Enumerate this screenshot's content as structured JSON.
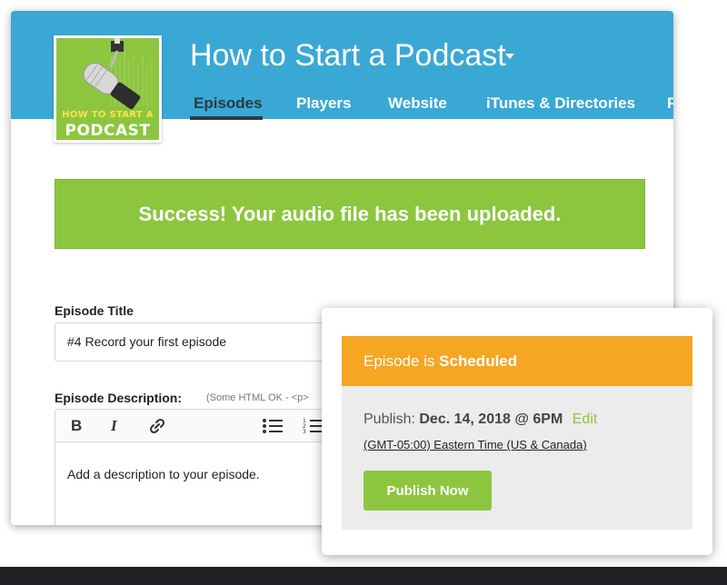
{
  "podcast": {
    "title": "How to Start a Podcast",
    "artwork": {
      "line1": "HOW TO START A",
      "line2": "PODCAST",
      "bg_color": "#8cc63f"
    }
  },
  "tabs": [
    {
      "label": "Episodes",
      "active": true
    },
    {
      "label": "Players",
      "active": false
    },
    {
      "label": "Website",
      "active": false
    },
    {
      "label": "iTunes & Directories",
      "active": false
    },
    {
      "label": "P",
      "active": false
    }
  ],
  "banner": {
    "text": "Success! Your audio file has been uploaded.",
    "color": "#8cc63f"
  },
  "form": {
    "episode_title_label": "Episode Title",
    "episode_title_value": "#4 Record your first episode",
    "description_label": "Episode Description:",
    "description_hint": "(Some HTML OK - <p>",
    "description_placeholder": "Add a description to your episode.",
    "toolbar": [
      {
        "name": "bold",
        "glyph": "B"
      },
      {
        "name": "italic",
        "glyph": "I"
      },
      {
        "name": "link",
        "icon": "link-icon"
      },
      {
        "name": "bulleted-list",
        "icon": "bulleted-list-icon"
      },
      {
        "name": "numbered-list",
        "icon": "numbered-list-icon"
      }
    ]
  },
  "schedule": {
    "status_prefix": "Episode is",
    "status": "Scheduled",
    "status_color": "#f5a623",
    "publish_label": "Publish:",
    "publish_date": "Dec. 14, 2018 @ 6PM",
    "edit_label": "Edit",
    "timezone": "(GMT-05:00) Eastern Time (US & Canada)",
    "publish_now_label": "Publish Now"
  },
  "colors": {
    "header": "#3aa8d5",
    "accent_green": "#8cc63f",
    "active_tab": "#2a3a45"
  }
}
